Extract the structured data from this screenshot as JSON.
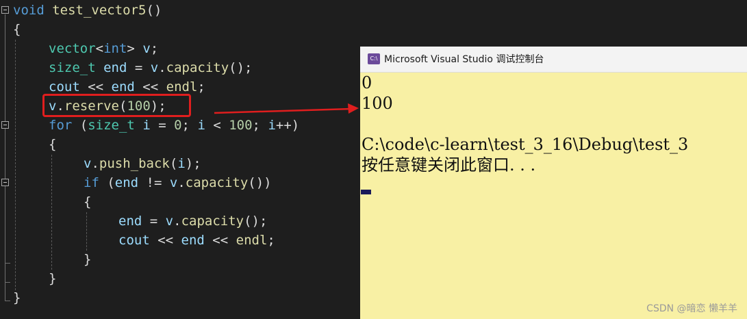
{
  "editor": {
    "lines": [
      {
        "tokens": [
          {
            "t": "void",
            "c": "kw"
          },
          {
            "t": " ",
            "c": "pu"
          },
          {
            "t": "test_vector5",
            "c": "fn"
          },
          {
            "t": "()",
            "c": "pu"
          }
        ]
      },
      {
        "tokens": [
          {
            "t": "{",
            "c": "pu"
          }
        ]
      },
      {
        "tokens": [
          {
            "t": "vector",
            "c": "ty"
          },
          {
            "t": "<",
            "c": "pu"
          },
          {
            "t": "int",
            "c": "kw"
          },
          {
            "t": "> ",
            "c": "pu"
          },
          {
            "t": "v",
            "c": "var"
          },
          {
            "t": ";",
            "c": "pu"
          }
        ]
      },
      {
        "tokens": [
          {
            "t": "size_t",
            "c": "ty"
          },
          {
            "t": " ",
            "c": "pu"
          },
          {
            "t": "end",
            "c": "var"
          },
          {
            "t": " = ",
            "c": "pu"
          },
          {
            "t": "v",
            "c": "var"
          },
          {
            "t": ".",
            "c": "pu"
          },
          {
            "t": "capacity",
            "c": "fn"
          },
          {
            "t": "();",
            "c": "pu"
          }
        ]
      },
      {
        "tokens": [
          {
            "t": "cout",
            "c": "var"
          },
          {
            "t": " << ",
            "c": "pu"
          },
          {
            "t": "end",
            "c": "var"
          },
          {
            "t": " << ",
            "c": "pu"
          },
          {
            "t": "endl",
            "c": "fn"
          },
          {
            "t": ";",
            "c": "pu"
          }
        ]
      },
      {
        "tokens": [
          {
            "t": "v",
            "c": "var"
          },
          {
            "t": ".",
            "c": "pu"
          },
          {
            "t": "reserve",
            "c": "fn"
          },
          {
            "t": "(",
            "c": "pu"
          },
          {
            "t": "100",
            "c": "num"
          },
          {
            "t": ");",
            "c": "pu"
          }
        ]
      },
      {
        "tokens": [
          {
            "t": "for",
            "c": "kw"
          },
          {
            "t": " (",
            "c": "pu"
          },
          {
            "t": "size_t",
            "c": "ty"
          },
          {
            "t": " ",
            "c": "pu"
          },
          {
            "t": "i",
            "c": "var"
          },
          {
            "t": " = ",
            "c": "pu"
          },
          {
            "t": "0",
            "c": "num"
          },
          {
            "t": "; ",
            "c": "pu"
          },
          {
            "t": "i",
            "c": "var"
          },
          {
            "t": " < ",
            "c": "pu"
          },
          {
            "t": "100",
            "c": "num"
          },
          {
            "t": "; ",
            "c": "pu"
          },
          {
            "t": "i",
            "c": "var"
          },
          {
            "t": "++)",
            "c": "pu"
          }
        ]
      },
      {
        "tokens": [
          {
            "t": "{",
            "c": "pu"
          }
        ]
      },
      {
        "tokens": [
          {
            "t": "v",
            "c": "var"
          },
          {
            "t": ".",
            "c": "pu"
          },
          {
            "t": "push_back",
            "c": "fn"
          },
          {
            "t": "(",
            "c": "pu"
          },
          {
            "t": "i",
            "c": "var"
          },
          {
            "t": ");",
            "c": "pu"
          }
        ]
      },
      {
        "tokens": [
          {
            "t": "if",
            "c": "kw"
          },
          {
            "t": " (",
            "c": "pu"
          },
          {
            "t": "end",
            "c": "var"
          },
          {
            "t": " != ",
            "c": "pu"
          },
          {
            "t": "v",
            "c": "var"
          },
          {
            "t": ".",
            "c": "pu"
          },
          {
            "t": "capacity",
            "c": "fn"
          },
          {
            "t": "())",
            "c": "pu"
          }
        ]
      },
      {
        "tokens": [
          {
            "t": "{",
            "c": "pu"
          }
        ]
      },
      {
        "tokens": [
          {
            "t": "end",
            "c": "var"
          },
          {
            "t": " = ",
            "c": "pu"
          },
          {
            "t": "v",
            "c": "var"
          },
          {
            "t": ".",
            "c": "pu"
          },
          {
            "t": "capacity",
            "c": "fn"
          },
          {
            "t": "();",
            "c": "pu"
          }
        ]
      },
      {
        "tokens": [
          {
            "t": "cout",
            "c": "var"
          },
          {
            "t": " << ",
            "c": "pu"
          },
          {
            "t": "end",
            "c": "var"
          },
          {
            "t": " << ",
            "c": "pu"
          },
          {
            "t": "endl",
            "c": "fn"
          },
          {
            "t": ";",
            "c": "pu"
          }
        ]
      },
      {
        "tokens": [
          {
            "t": "}",
            "c": "pu"
          }
        ]
      },
      {
        "tokens": [
          {
            "t": "}",
            "c": "pu"
          }
        ]
      },
      {
        "tokens": [
          {
            "t": "}",
            "c": "pu"
          }
        ]
      }
    ]
  },
  "console": {
    "icon": "C:\\",
    "title": "Microsoft Visual Studio 调试控制台",
    "output": [
      "0",
      "100",
      "",
      "C:\\code\\c-learn\\test_3_16\\Debug\\test_3",
      "按任意键关闭此窗口. . ."
    ]
  },
  "watermark": "CSDN @暗恋 懒羊羊",
  "colors": {
    "editor_bg": "#1e1e1e",
    "console_bg": "#f8f0a4",
    "highlight": "#e01e1e"
  }
}
